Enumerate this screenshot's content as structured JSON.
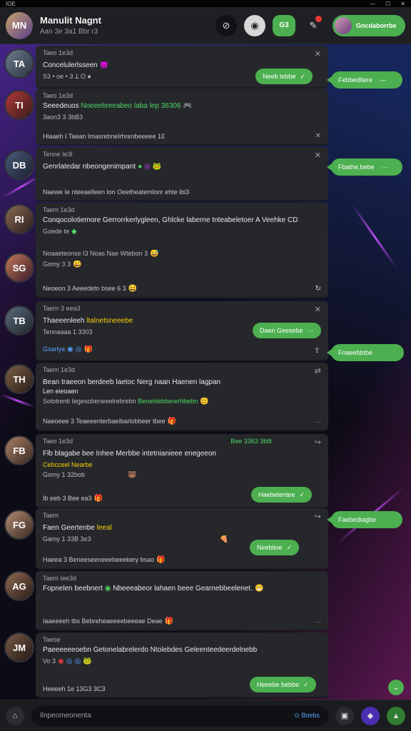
{
  "topbar": {
    "left": "IOE",
    "controls": [
      "—",
      "☐",
      "✕"
    ]
  },
  "header": {
    "avatar_initials": "MN",
    "name": "Manulit Nagnt",
    "subtitle": "Aan 3e 3a1 Bbr r3",
    "btn_lock": "⊘",
    "btn_record": "◉",
    "btn_green": "G3",
    "btn_edit": "✎",
    "profile_label": "Gncdaborrbe"
  },
  "cards": [
    {
      "avatar": "TA",
      "time": "Taeo 1e3d",
      "line1": "Concelulerlsseen",
      "line2": "S3 • oe • 3 ꓕ  O  ●",
      "reply": "Neeb tebbe",
      "close": "✕"
    },
    {
      "avatar": "TI",
      "time": "Taeo 1e3d",
      "line1_pre": "Seeedeuos",
      "line1_green": "Noeeebreeabeo laba lep 36306",
      "line2": "3aon3 3 3bB3",
      "footer": "Hlaaeh I Taean Imasrebnelrhrenbeeeee 1Ɛ",
      "dots": "···",
      "close": "✕"
    },
    {
      "avatar": "DB",
      "time": "Tenne Ie3l",
      "line1": "Genrlatedar nbeongenimpant",
      "footer": "Naewe Ie nteeaelleen lon Oeetheatemlonr ehte ibi3",
      "dots": "···",
      "close": "✕"
    },
    {
      "avatar": "RI",
      "time": "Taem 1e3d",
      "line1": "Conqocolotiemore Gerrorrkerlygleen, Ghlcke laberne tnteabeletoer A Veehke CD",
      "line2": "Goede te",
      "line3": "Noaaeteonse I3 Noas Nae Wtebon 3",
      "line4": "Gomy 3 3",
      "footer": "Neoeon 3 Aeeedetn bsee 6 3",
      "dots": "···"
    },
    {
      "avatar": "TB",
      "time": "Taern 3 eea3",
      "line1_pre": "Thaeeenleeh",
      "line1_yellow": "ltalnetsneeebe",
      "line2": "Tennaaaa 1 3303",
      "line3": "Gsarlya",
      "reply": "Daen Geesebe",
      "close": "✕"
    },
    {
      "avatar": "TH",
      "time": "Taern 1e3d",
      "line1": "Bean traeeon berdeeb laetoc Nerg naan Haenen lagpan",
      "line2": "Len eieoaen",
      "line3_pre": "Solotrenti Iegesobeneeelrebrebn",
      "line3_green": "Beneblebbererhbebn",
      "footer": "Naeoeee 3 Teaeeenterbaeibarlobbeer tbee",
      "dots": "···"
    },
    {
      "avatar": "FB",
      "time": "Taeo 1e3d",
      "line1": "Flb blagabe bee Inhee Merbbe intetnianieee enegeeon",
      "line2_yellow": "Cebcceel Nearbe",
      "line3": "Gomy 1 32bob",
      "line4": "Ib eeb 3 Bee ea3",
      "meta_green": "Bee 3363 3bllt",
      "reply": "Haebetentee",
      "close": "↪"
    },
    {
      "avatar": "FG",
      "time": "Taem",
      "line1": "Faen Geertenbe",
      "line1_yellow": "leeal",
      "line2": "Gamy 1 33B 3e3",
      "footer": "Haeea 3 Beneeseeneeebeeekery bsao",
      "reply": "Neeblioe",
      "close": "↪"
    },
    {
      "avatar": "AG",
      "time": "Taem Iee3d",
      "line1": "Fopnelen beebnert",
      "line1_rest": "Nbeeeabeor lahaen beee Gearnebbeelenet.",
      "footer": "Iaaeeeeh tbs Bebreheaeeeebeeeae Deae",
      "dots": "···"
    },
    {
      "avatar": "JM",
      "time": "Taeoe",
      "line1": "Paeeeeeeoebn Getonelabrelerdo Ntolebdes Geleenteedeerdelnebb",
      "line2": "Vo 3",
      "footer": "Heeeeh 1e 13G3 3C3",
      "reply": "Heeebe bebbe",
      "close": "↪"
    }
  ],
  "side_bubbles": [
    {
      "label": "Febbedtlere"
    },
    {
      "label": "Fbathe,bebe"
    },
    {
      "label": "Fnaeebbtbe"
    },
    {
      "label": "Faebedtagbe"
    }
  ],
  "composer": {
    "placeholder": "Ilnpeomeonenta",
    "emoji_count": "⊙ Boebs",
    "attach_icon": "⌂",
    "doc_icon": "▣",
    "brand_icon": "◆",
    "send_icon": "▲"
  },
  "colors": {
    "accent": "#4caf50",
    "card": "#26272b",
    "header": "#1f2024"
  }
}
